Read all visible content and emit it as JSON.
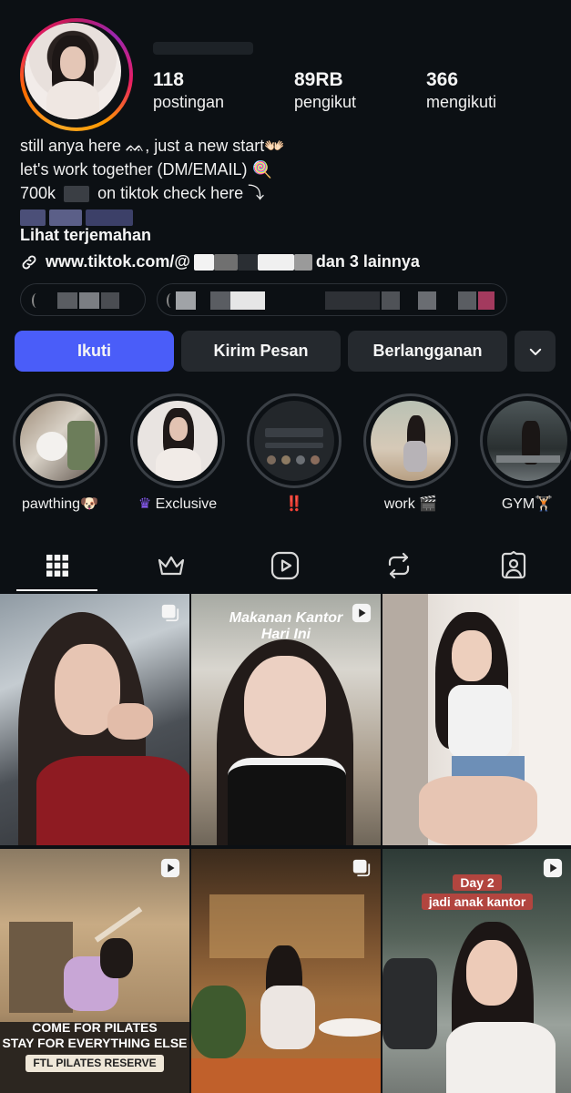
{
  "profile": {
    "stats": [
      {
        "value": "118",
        "label": "postingan"
      },
      {
        "value": "89RB",
        "label": "pengikut"
      },
      {
        "value": "366",
        "label": "mengikuti"
      }
    ],
    "bio": {
      "line1": "still anya here ᨐ, just a new start👐🏻",
      "line2": "let's work together (DM/EMAIL) 🍭",
      "line3_start": "700k",
      "line3_end": "on tiktok check here ⤵",
      "translate": "Lihat terjemahan",
      "link_prefix": "www.tiktok.com/@",
      "link_suffix": "dan 3 lainnya"
    }
  },
  "actions": {
    "follow": "Ikuti",
    "message": "Kirim Pesan",
    "subscribe": "Berlangganan"
  },
  "highlights": [
    {
      "label": "pawthing🐶"
    },
    {
      "label": "Exclusive",
      "badge": "crown"
    },
    {
      "label": "‼️"
    },
    {
      "label": "work 🎬"
    },
    {
      "label": "GYM🏋🏻"
    }
  ],
  "tabs": [
    {
      "name": "posts-grid-icon"
    },
    {
      "name": "exclusive-crown-icon"
    },
    {
      "name": "reels-icon"
    },
    {
      "name": "reposts-icon"
    },
    {
      "name": "tagged-icon"
    }
  ],
  "grid": {
    "post2_caption_line1": "Makanan Kantor",
    "post2_caption_line2": "Hari Ini",
    "post4_caption_line1": "COME FOR PILATES",
    "post4_caption_line2": "STAY FOR EVERYTHING ELSE",
    "post4_caption_line3": "FTL PILATES RESERVE",
    "post6_caption_line1": "Day 2",
    "post6_caption_line2": "jadi anak kantor"
  },
  "colors": {
    "background": "#0c1014",
    "follow_button": "#4a5df9",
    "secondary_button": "#25292e"
  }
}
